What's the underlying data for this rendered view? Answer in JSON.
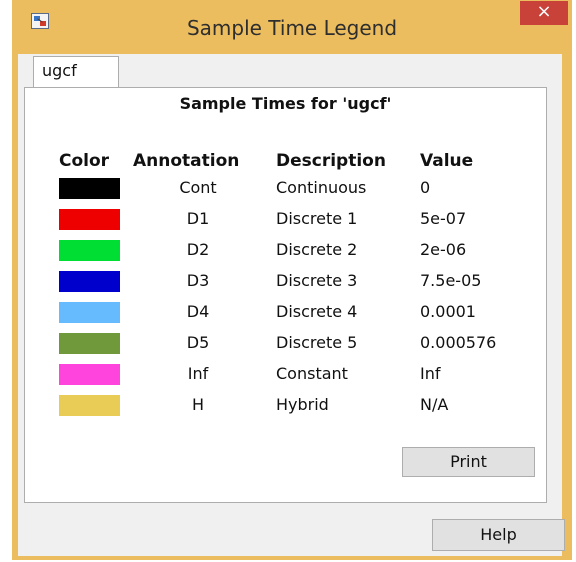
{
  "window": {
    "title": "Sample Time Legend",
    "close_glyph": "×"
  },
  "tab": {
    "label": "ugcf"
  },
  "panel": {
    "heading": "Sample Times for 'ugcf'",
    "columns": {
      "color": "Color",
      "annotation": "Annotation",
      "description": "Description",
      "value": "Value"
    },
    "rows": [
      {
        "color": "#000000",
        "annotation": "Cont",
        "description": "Continuous",
        "value": "0"
      },
      {
        "color": "#ee0000",
        "annotation": "D1",
        "description": "Discrete 1",
        "value": "5e-07"
      },
      {
        "color": "#00dd33",
        "annotation": "D2",
        "description": "Discrete 2",
        "value": "2e-06"
      },
      {
        "color": "#0000cc",
        "annotation": "D3",
        "description": "Discrete 3",
        "value": "7.5e-05"
      },
      {
        "color": "#66bbff",
        "annotation": "D4",
        "description": "Discrete 4",
        "value": "0.0001"
      },
      {
        "color": "#6f993a",
        "annotation": "D5",
        "description": "Discrete 5",
        "value": "0.000576"
      },
      {
        "color": "#ff44dd",
        "annotation": "Inf",
        "description": "Constant",
        "value": "Inf"
      },
      {
        "color": "#e8cc55",
        "annotation": "H",
        "description": "Hybrid",
        "value": "N/A"
      }
    ]
  },
  "buttons": {
    "print": "Print",
    "help": "Help"
  },
  "icons": {
    "app": "simulink-app-icon",
    "close": "close-icon"
  }
}
